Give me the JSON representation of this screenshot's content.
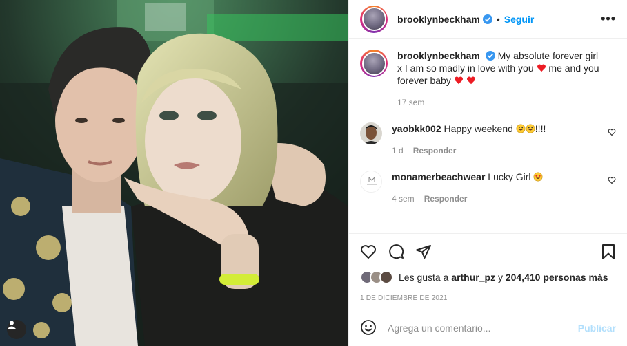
{
  "post": {
    "author": "brooklynbeckham",
    "follow_label": "Seguir",
    "separator": "•",
    "more_label": "•••"
  },
  "caption": {
    "user": "brooklynbeckham",
    "text_part1": "My absolute forever girl x I am so madly in love with you",
    "text_part2": "me and you forever baby",
    "time": "17 sem"
  },
  "comments": [
    {
      "user": "yaobkk002",
      "text": "Happy weekend",
      "suffix": "!!!!",
      "time": "1 d",
      "reply": "Responder"
    },
    {
      "user": "monamerbeachwear",
      "text": "Lucky Girl",
      "time": "4 sem",
      "reply": "Responder"
    }
  ],
  "likes": {
    "prefix": "Les gusta a",
    "user": "arthur_pz",
    "connector": "y",
    "count": "204,410 personas más"
  },
  "date": "1 DE DICIEMBRE DE 2021",
  "add_comment": {
    "placeholder": "Agrega un comentario...",
    "publish": "Publicar"
  },
  "icons": {
    "verified": "verified-badge-icon",
    "like": "heart-icon",
    "comment": "comment-icon",
    "share": "paper-plane-icon",
    "save": "bookmark-icon",
    "emoji": "smiley-icon",
    "tag": "user-tag-icon"
  },
  "colors": {
    "accent": "#0095f6",
    "publish_disabled": "#b2dffc",
    "heart_red": "#ed1c24",
    "muted": "#8e8e8e"
  }
}
